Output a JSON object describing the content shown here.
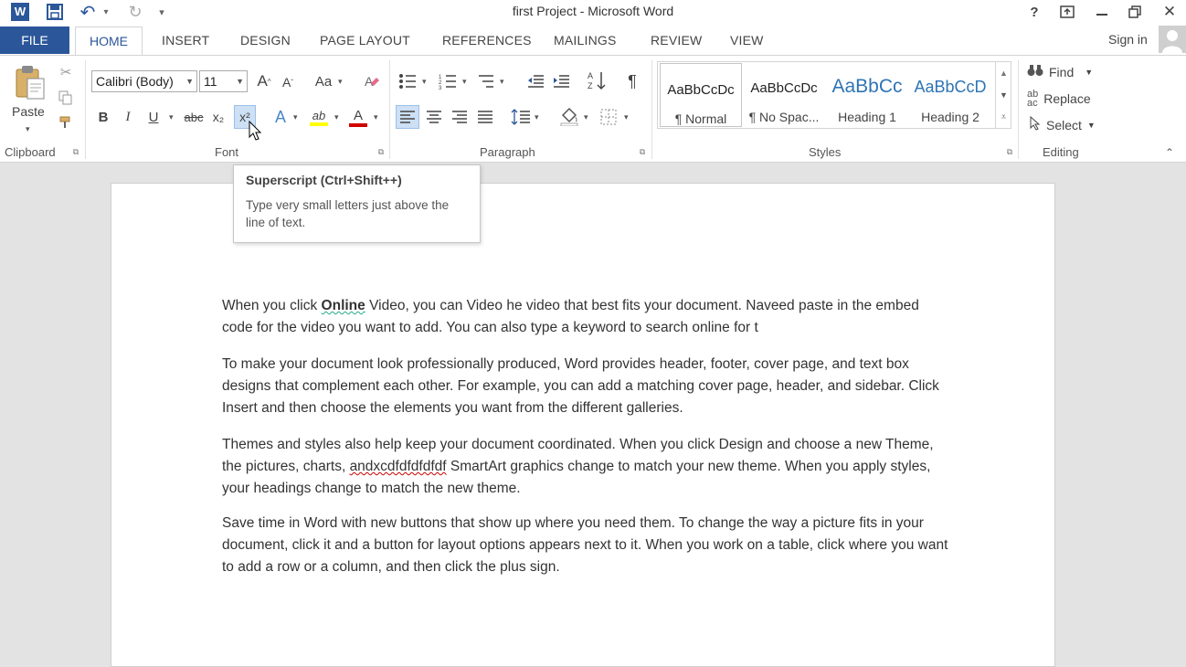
{
  "window": {
    "title": "first Project - Microsoft Word",
    "controls": {
      "help": "?",
      "restore_ribbon": "⇱",
      "minimize": "—",
      "restore": "❐",
      "close": "✕"
    }
  },
  "quick_access": {
    "word_icon": "W",
    "save": "💾",
    "undo": "↶",
    "redo": "↻",
    "customize": "▾"
  },
  "tabs": [
    "FILE",
    "HOME",
    "INSERT",
    "DESIGN",
    "PAGE LAYOUT",
    "REFERENCES",
    "MAILINGS",
    "REVIEW",
    "VIEW"
  ],
  "active_tab": "HOME",
  "account": {
    "sign_in": "Sign in"
  },
  "ribbon": {
    "clipboard": {
      "label": "Clipboard",
      "paste": "Paste"
    },
    "font": {
      "label": "Font",
      "family": "Calibri (Body)",
      "size": "11",
      "grow": "A",
      "shrink": "A",
      "change_case": "Aa",
      "bold": "B",
      "italic": "I",
      "underline": "U",
      "strikethrough": "abc",
      "subscript": "x₂",
      "superscript": "x²",
      "text_effects": "A",
      "highlight": "ab",
      "font_color": "A"
    },
    "paragraph": {
      "label": "Paragraph",
      "show_hide": "¶"
    },
    "styles": {
      "label": "Styles",
      "items": [
        {
          "preview": "AaBbCcDc",
          "name": "¶ Normal"
        },
        {
          "preview": "AaBbCcDc",
          "name": "¶ No Spac..."
        },
        {
          "preview": "AaBbCc",
          "name": "Heading 1"
        },
        {
          "preview": "AaBbCcD",
          "name": "Heading 2"
        }
      ]
    },
    "editing": {
      "label": "Editing",
      "find": "Find",
      "replace": "Replace",
      "select": "Select"
    }
  },
  "tooltip": {
    "title": "Superscript (Ctrl+Shift++)",
    "body": "Type very small letters just above the line of text."
  },
  "document": {
    "p1": {
      "before": "When you click ",
      "bold": "Online",
      "mid": " Video, you can Video he video that best fits your document. Naveed paste in the embed code for the video you want to add. You can also type a keyword to search online for t"
    },
    "p2": "To make your document look professionally produced, Word provides header, footer, cover page, and text box designs that complement each other. For example, you can add a matching cover page, header, and sidebar. Click Insert and then choose the elements you want from the different galleries.",
    "p3": {
      "before": "Themes and styles also help keep your document coordinated. When you click Design and choose a new Theme, the pictures, charts, ",
      "misspelled": "andxcdfdfdfdfdf",
      "after": " SmartArt graphics change to match your new theme. When you apply styles, your headings change to match the new theme."
    },
    "p4": "Save time in Word with new buttons that show up where you need them. To change the way a picture fits in your document, click it and a button for layout options appears next to it. When you work on a table, click where you want to add a row or a column, and then click the plus sign."
  },
  "colors": {
    "accent": "#2b579a",
    "highlight": "#ffff00",
    "font_color": "#d00000"
  }
}
